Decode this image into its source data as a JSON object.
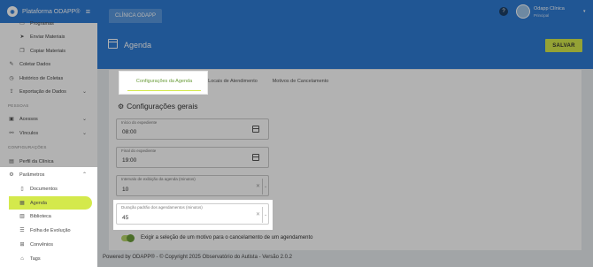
{
  "app": {
    "brand": "Plataforma ODAPP®"
  },
  "sidebar": {
    "items": [
      {
        "label": "Programas",
        "icon": "folder-icon"
      },
      {
        "label": "Enviar Materiais",
        "icon": "send-icon"
      },
      {
        "label": "Copiar Materiais",
        "icon": "copy-icon"
      },
      {
        "label": "Coletar Dados",
        "icon": "edit-icon"
      },
      {
        "label": "Histórico de Coletas",
        "icon": "history-icon"
      },
      {
        "label": "Exportação de Dados",
        "icon": "export-icon"
      },
      {
        "label": "Acessos",
        "icon": "id-card-icon"
      },
      {
        "label": "Vínculos",
        "icon": "link-icon"
      },
      {
        "label": "Perfil da Clínica",
        "icon": "clinic-icon"
      },
      {
        "label": "Parâmetros",
        "icon": "settings-icon"
      },
      {
        "label": "Documentos",
        "icon": "document-icon"
      },
      {
        "label": "Agenda",
        "icon": "calendar-icon"
      },
      {
        "label": "Biblioteca",
        "icon": "library-icon"
      },
      {
        "label": "Folha de Evolução",
        "icon": "list-icon"
      },
      {
        "label": "Convênios",
        "icon": "agreement-icon"
      },
      {
        "label": "Tags",
        "icon": "tag-icon"
      }
    ],
    "sections": {
      "people": "PESSOAS",
      "config": "CONFIGURAÇÕES"
    }
  },
  "topbar": {
    "tab": "CLÍNICA ODAPP",
    "user_name": "Odapp Clínica",
    "user_role": "Principal"
  },
  "page": {
    "title": "Agenda",
    "save_label": "SALVAR"
  },
  "tabs": [
    "Configurações da Agenda",
    "Locais de Atendimento",
    "Motivos de Cancelamento"
  ],
  "settings": {
    "section_title": "Configurações gerais",
    "start_label": "Início do expediente",
    "start_value": "08:00",
    "end_label": "Final do expediente",
    "end_value": "19:00",
    "interval_label": "Intervalo de exibição da agenda (minutos)",
    "interval_value": "10",
    "duration_label": "Duração padrão dos agendamentos (minutos)",
    "duration_value": "45",
    "toggle_label": "Exigir a seleção de um motivo para o cancelamento de um agendamento",
    "toggle_on": true
  },
  "footer": {
    "text": "Powered by ODAPP® - © Copyright 2025 Observatório do Autista - Versão 2.0.2"
  },
  "colors": {
    "primary": "#2e7bd5",
    "accent": "#d4e94c",
    "active_text": "#6a9c3a"
  }
}
